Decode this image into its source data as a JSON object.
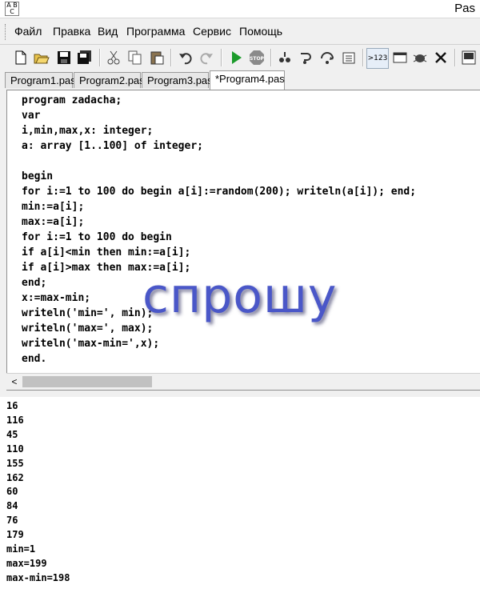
{
  "window": {
    "title": "Pas"
  },
  "menu": [
    "Файл",
    "Правка",
    "Вид",
    "Программа",
    "Сервис",
    "Помощь"
  ],
  "toolbar_icons": [
    "new-file-icon",
    "open-icon",
    "save-icon",
    "save-all-icon",
    "cut-icon",
    "copy-icon",
    "paste-icon",
    "undo-icon",
    "redo-icon",
    "run-icon",
    "stop-icon",
    "step-icon",
    "step-into-icon",
    "step-over-icon",
    "watch-icon",
    "format-icon",
    "window-icon",
    "debug-icon",
    "close-icon",
    "exe-icon"
  ],
  "toolbar_format_label": ">123",
  "tabs": [
    "Program1.pas",
    "Program2.pas",
    "Program3.pas",
    "*Program4.pas"
  ],
  "code_lines": [
    "program zadacha;",
    "var",
    "i,min,max,x: integer;",
    "a: array [1..100] of integer;",
    "",
    "begin",
    "for i:=1 to 100 do begin a[i]:=random(200); writeln(a[i]); end;",
    "min:=a[i];",
    "max:=a[i];",
    "for i:=1 to 100 do begin",
    "if a[i]<min then min:=a[i];",
    "if a[i]>max then max:=a[i];",
    "end;",
    "x:=max-min;",
    "writeln('min=', min);",
    "writeln('max=', max);",
    "writeln('max-min=',x);",
    "end."
  ],
  "output_lines": [
    "16",
    "116",
    "45",
    "110",
    "155",
    "162",
    "60",
    "84",
    "76",
    "179",
    "min=1",
    "max=199",
    "max-min=198"
  ],
  "watermark": "спрошу"
}
